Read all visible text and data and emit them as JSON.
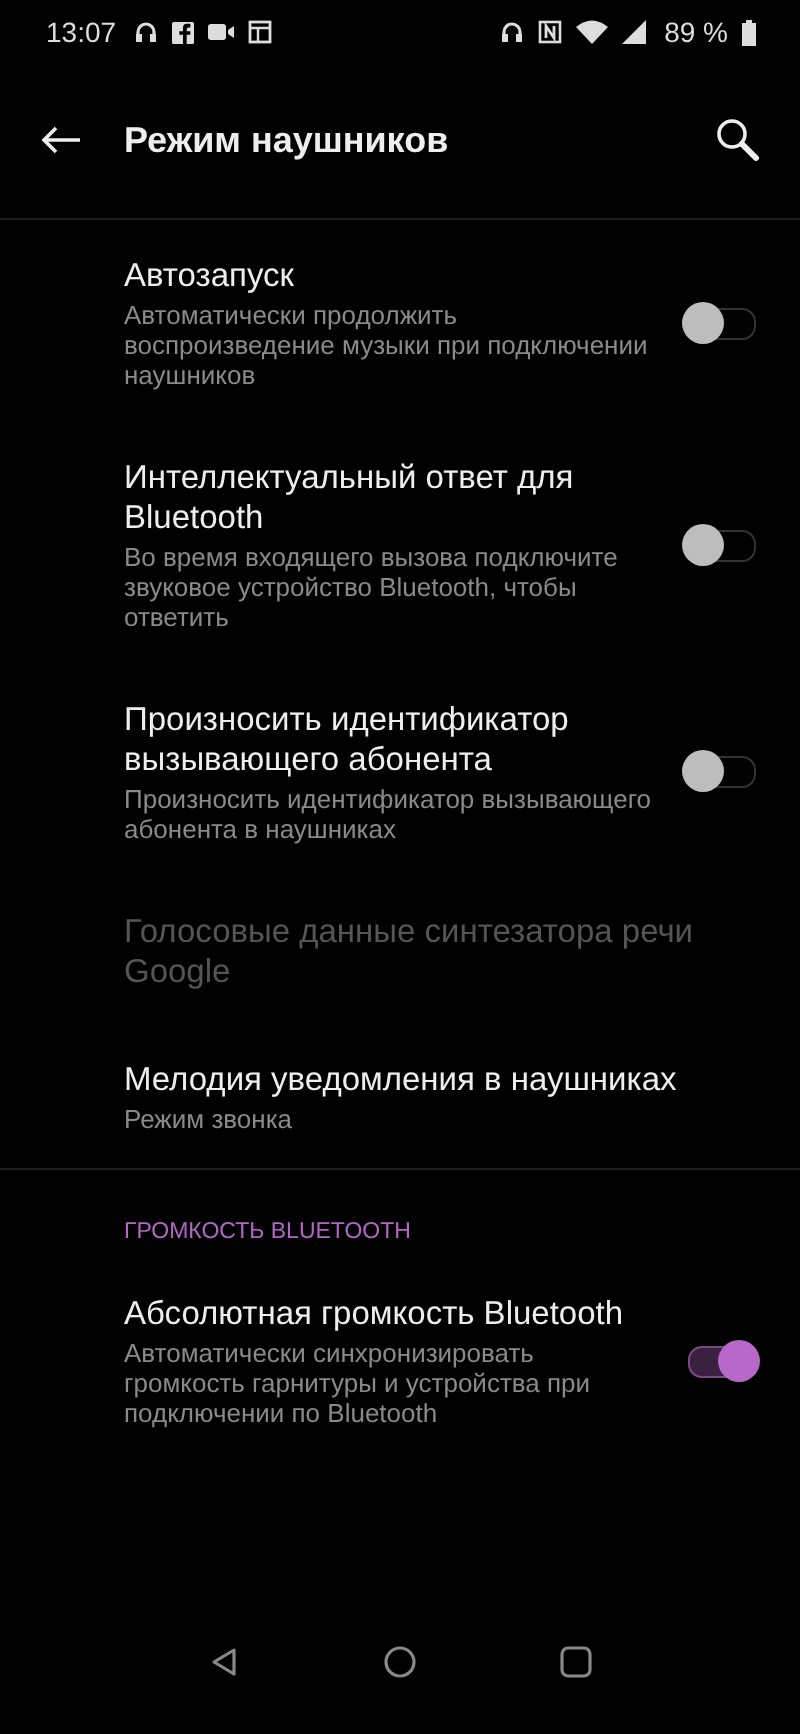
{
  "status_bar": {
    "time": "13:07",
    "battery": "89 %"
  },
  "app_bar": {
    "title": "Режим наушников"
  },
  "sections": [
    {
      "items": [
        {
          "kind": "toggle",
          "title": "Автозапуск",
          "subtitle": "Автоматически продолжить воспроизведение музыки при подключении наушников",
          "on": false
        },
        {
          "kind": "toggle",
          "title": "Интеллектуальный ответ для Bluetooth",
          "subtitle": "Во время входящего вызова подключите звуковое устройство Bluetooth, чтобы ответить",
          "on": false
        },
        {
          "kind": "toggle",
          "title": "Произносить идентификатор вызывающего абонента",
          "subtitle": "Произносить идентификатор вызывающего абонента в наушниках",
          "on": false
        },
        {
          "kind": "link",
          "title": "Голосовые данные синтезатора речи Google",
          "disabled": true
        },
        {
          "kind": "link",
          "title": "Мелодия уведомления в наушниках",
          "subtitle": "Режим звонка",
          "disabled": false
        }
      ]
    },
    {
      "header": "ГРОМКОСТЬ BLUETOOTH",
      "items": [
        {
          "kind": "toggle",
          "title": "Абсолютная громкость Bluetooth",
          "subtitle": "Автоматически синхронизировать громкость гарнитуры и устройства при подключении по Bluetooth",
          "on": true
        }
      ]
    }
  ]
}
